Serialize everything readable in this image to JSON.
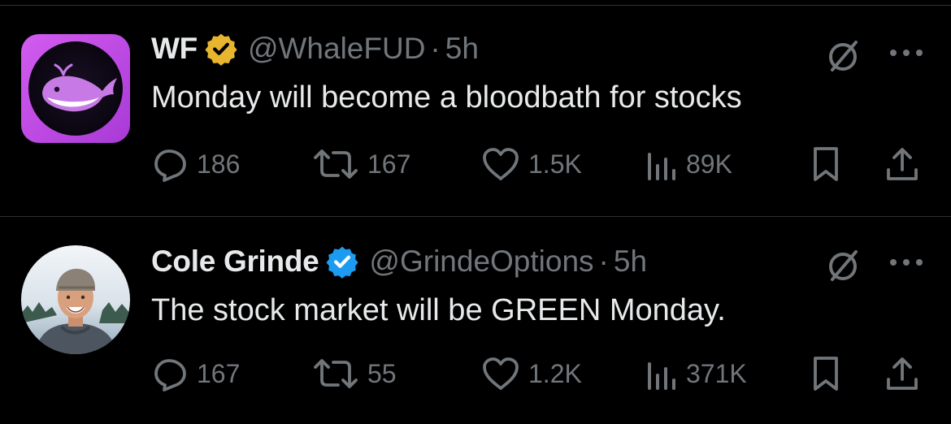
{
  "colors": {
    "background": "#000000",
    "text_primary": "#e7e9ea",
    "text_secondary": "#71767b",
    "divider": "#2f3336",
    "gold_badge": "#e8b52e",
    "blue_badge": "#1d9bf0",
    "whale_avatar_bg": "#c04fe0"
  },
  "tweets": [
    {
      "display_name": "WF",
      "verified_badge": "gold-checkmark-badge",
      "handle": "@WhaleFUD",
      "separator": "·",
      "time": "5h",
      "text": "Monday will become a bloodbath for stocks",
      "avatar": "whale-logo",
      "actions": {
        "replies": "186",
        "reposts": "167",
        "likes": "1.5K",
        "views": "89K"
      }
    },
    {
      "display_name": "Cole Grinde",
      "verified_badge": "blue-checkmark-badge",
      "handle": "@GrindeOptions",
      "separator": "·",
      "time": "5h",
      "text": "The stock market will be GREEN Monday.",
      "avatar": "profile-photo",
      "actions": {
        "replies": "167",
        "reposts": "55",
        "likes": "1.2K",
        "views": "371K"
      }
    }
  ],
  "icons": [
    "grok-icon",
    "more-icon",
    "reply-icon",
    "repost-icon",
    "like-icon",
    "views-icon",
    "bookmark-icon",
    "share-icon"
  ]
}
